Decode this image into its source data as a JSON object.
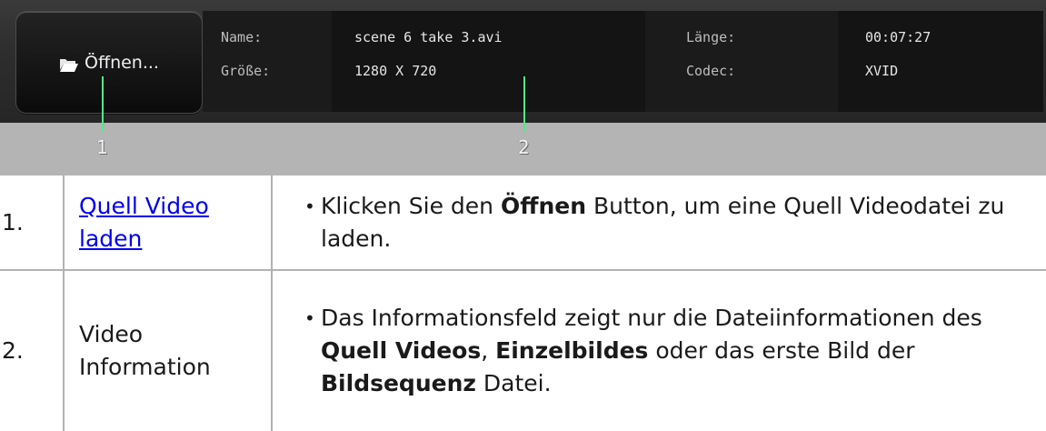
{
  "toolbar": {
    "open_button_label": "Öffnen...",
    "info": {
      "name_label": "Name:",
      "name_value": "scene 6 take 3.avi",
      "size_label": "Größe:",
      "size_value": "1280 X 720",
      "length_label": "Länge:",
      "length_value": "00:07:27",
      "codec_label": "Codec:",
      "codec_value": "XVID"
    },
    "callouts": [
      "1",
      "2"
    ],
    "colors": {
      "callout_line": "#56e889",
      "toolbar_bg": "#2e2e2e"
    }
  },
  "rows": [
    {
      "number": "1.",
      "topic": "Quell Video laden",
      "topic_is_link": true,
      "parts": [
        {
          "text": "Klicken Sie den ",
          "bold": false
        },
        {
          "text": "Öffnen",
          "bold": true
        },
        {
          "text": " Button, um eine Quell Videodatei zu laden.",
          "bold": false
        }
      ]
    },
    {
      "number": "2.",
      "topic": "Video Information",
      "topic_is_link": false,
      "parts": [
        {
          "text": "Das Informationsfeld zeigt nur die Dateiinformationen des ",
          "bold": false
        },
        {
          "text": "Quell Videos",
          "bold": true
        },
        {
          "text": ", ",
          "bold": false
        },
        {
          "text": "Einzelbildes",
          "bold": true
        },
        {
          "text": " oder das erste Bild der ",
          "bold": false
        },
        {
          "text": "Bildsequenz",
          "bold": true
        },
        {
          "text": " Datei.",
          "bold": false
        }
      ]
    }
  ]
}
